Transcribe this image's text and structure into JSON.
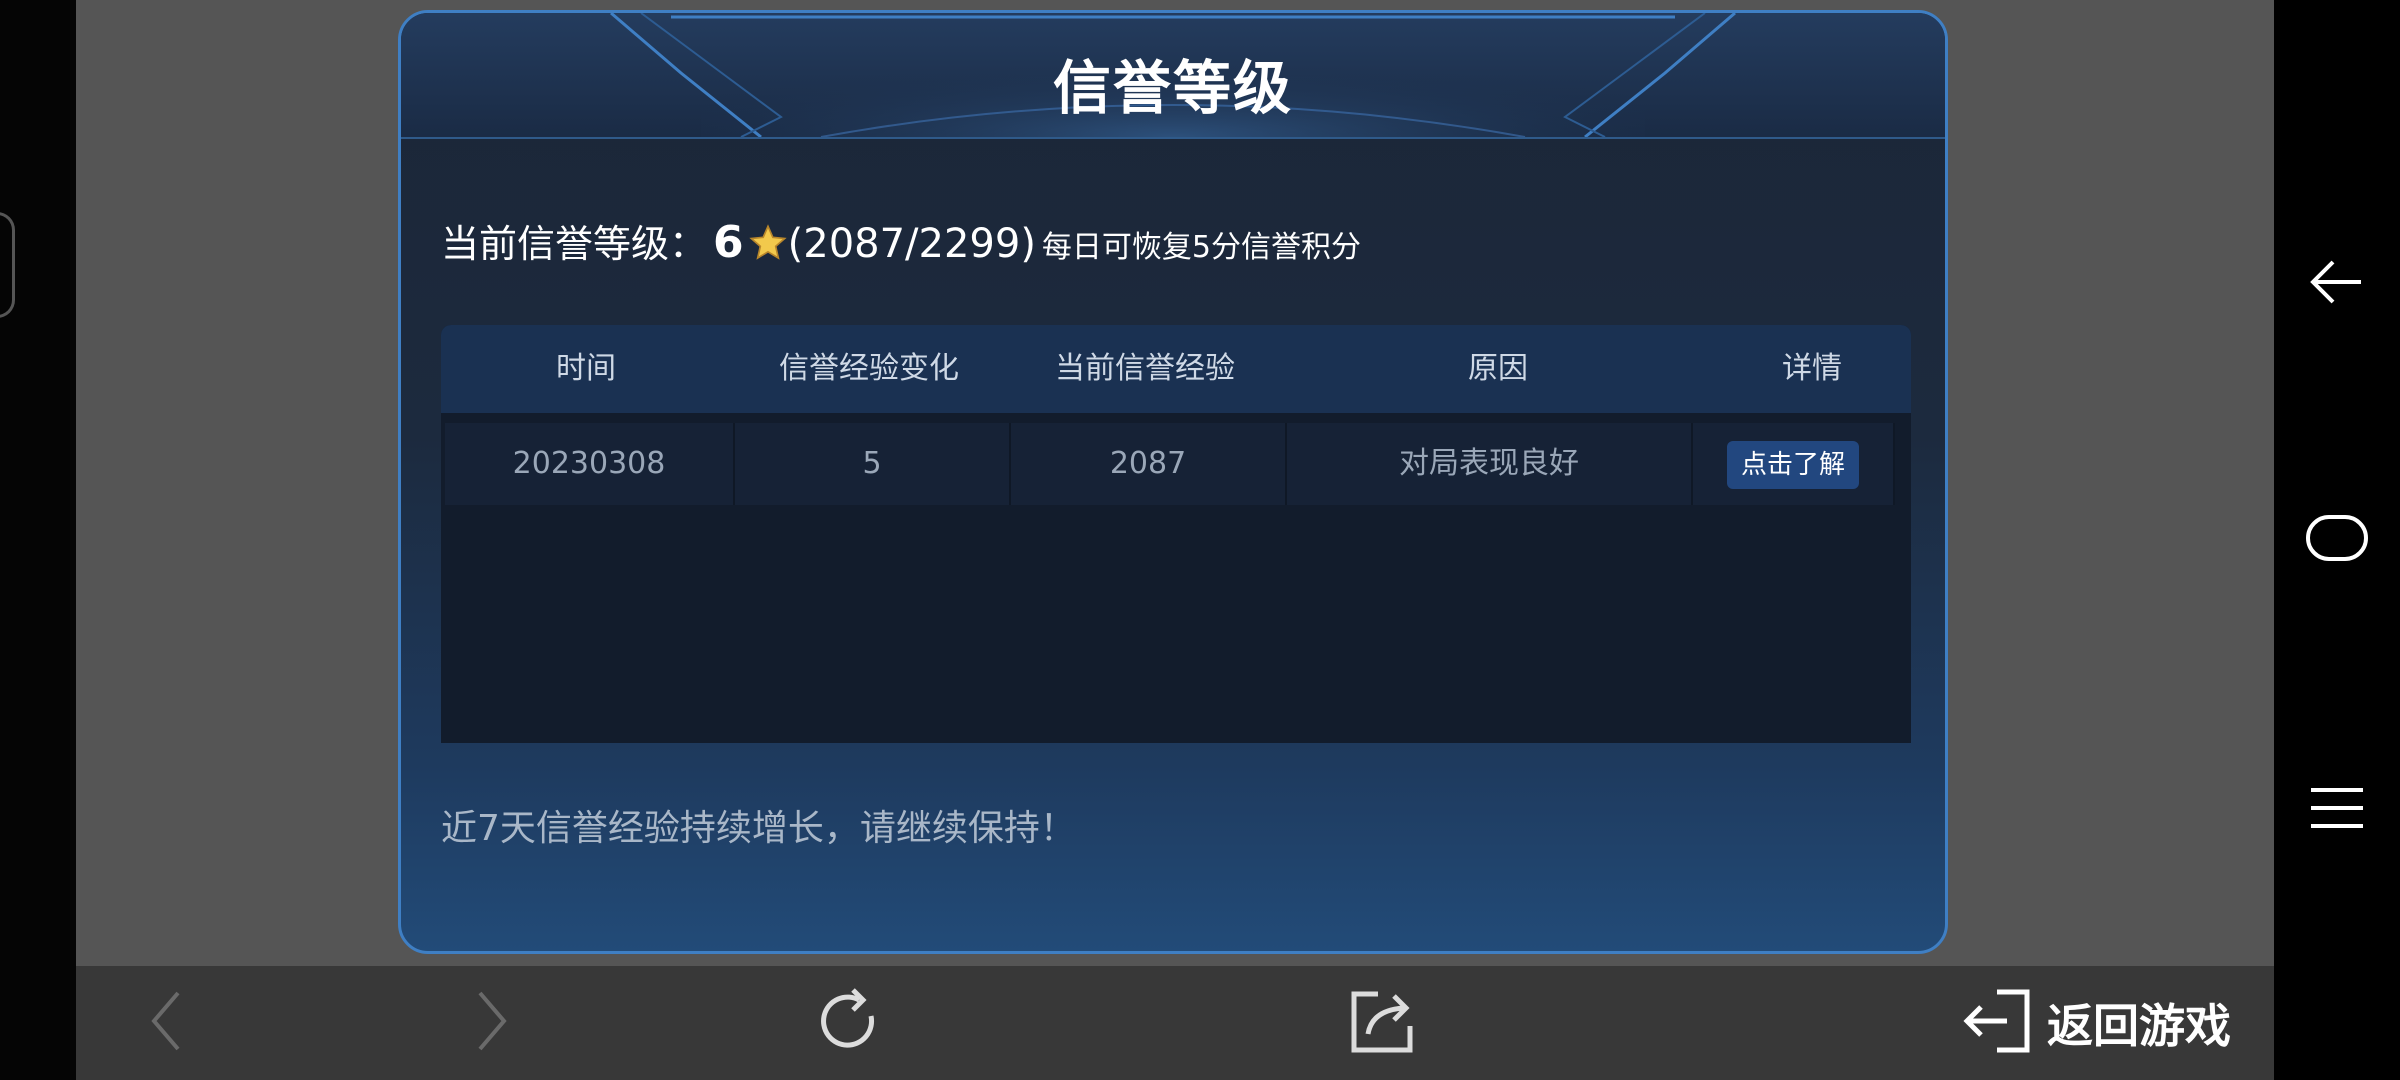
{
  "dialog": {
    "title": "信誉等级",
    "credit": {
      "label": "当前信誉等级：",
      "level": "6",
      "progress": "(2087/2299)",
      "note": "每日可恢复5分信誉积分"
    },
    "table": {
      "headers": [
        "时间",
        "信誉经验变化",
        "当前信誉经验",
        "原因",
        "详情"
      ],
      "rows": [
        {
          "date": "20230308",
          "change": "5",
          "current": "2087",
          "reason": "对局表现良好",
          "detail_button": "点击了解"
        }
      ]
    },
    "footer_message": "近7天信誉经验持续增长，请继续保持！"
  },
  "toolbar": {
    "back_to_game": "返回游戏"
  },
  "icons": {
    "star": "star-icon",
    "back": "back-arrow-icon",
    "forward": "forward-arrow-icon",
    "refresh": "refresh-icon",
    "share": "share-icon",
    "exit": "exit-icon",
    "sys_back": "system-back-icon",
    "sys_home": "system-home-icon",
    "sys_menu": "system-menu-icon"
  },
  "colors": {
    "dialog_border": "#3f7fc4",
    "table_header": "#1a3152",
    "button": "#22477f",
    "star": "#f2c94c"
  }
}
